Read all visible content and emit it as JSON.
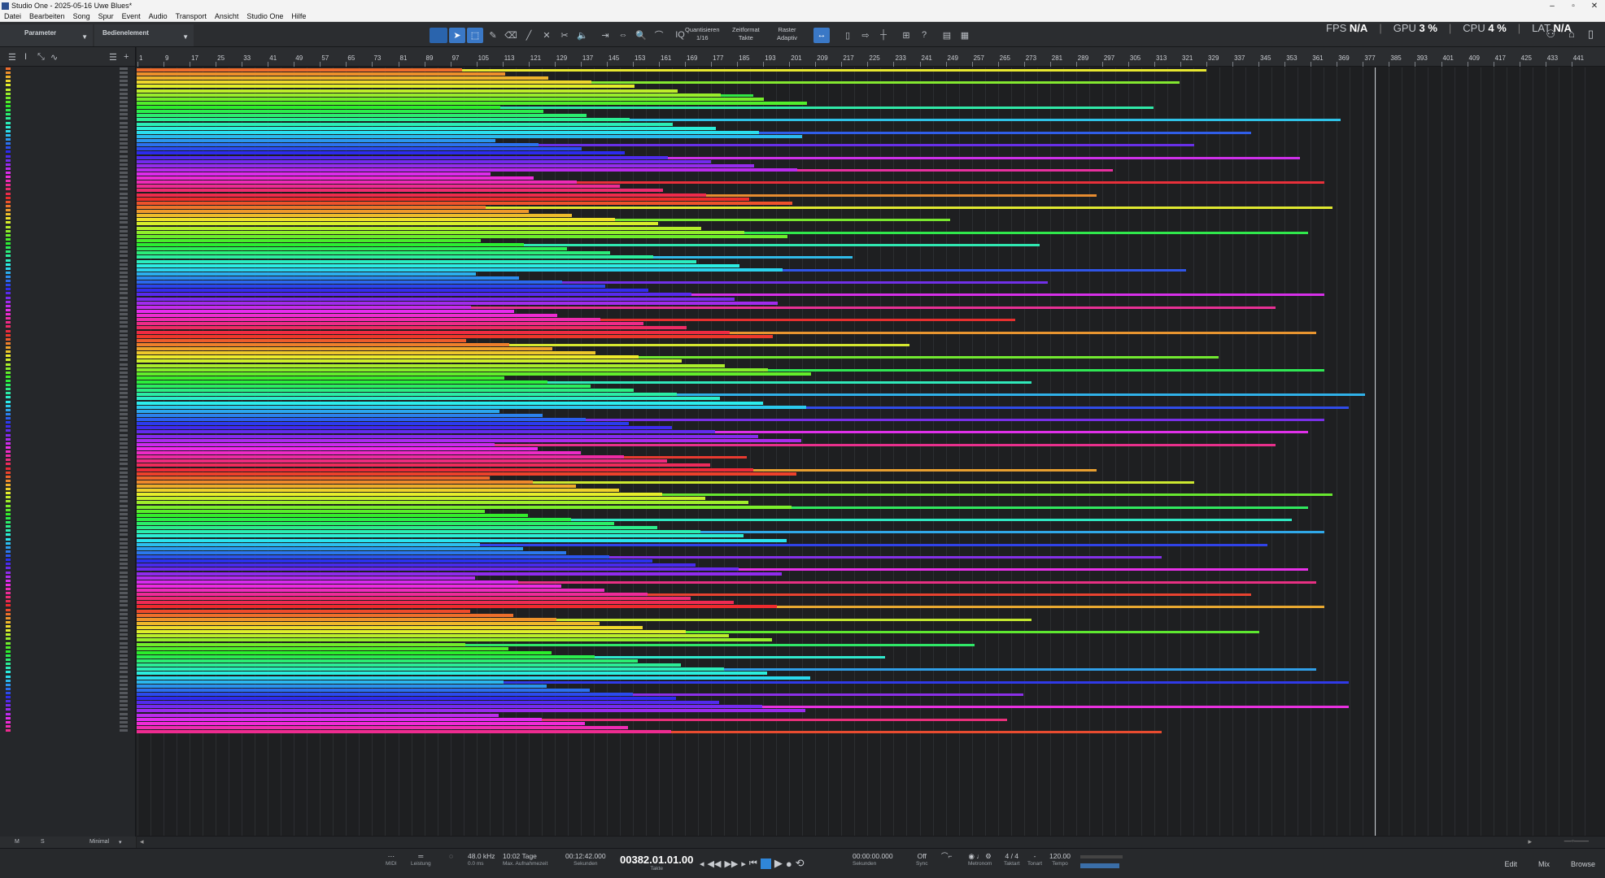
{
  "window": {
    "title": "Studio One - 2025-05-16 Uwe Blues*",
    "min": "–",
    "max": "▫",
    "close": "✕"
  },
  "menu": [
    "Datei",
    "Bearbeiten",
    "Song",
    "Spur",
    "Event",
    "Audio",
    "Transport",
    "Ansicht",
    "Studio One",
    "Hilfe"
  ],
  "toolbar": {
    "parameter_label": "Parameter",
    "bedienelement_label": "Bedienelement",
    "quantize": {
      "label": "Quantisieren",
      "value": "1/16"
    },
    "timeformat": {
      "label": "Zeitformat",
      "value": "Takte"
    },
    "raster": {
      "label": "Raster",
      "value": "Adaptiv"
    },
    "help": "?"
  },
  "stats": {
    "fps_label": "FPS",
    "fps_value": "N/A",
    "gpu_label": "GPU",
    "gpu_value": "3 %",
    "cpu_label": "CPU",
    "cpu_value": "4 %",
    "lat_label": "LAT",
    "lat_value": "N/A"
  },
  "leftpanel": {
    "m": "M",
    "s": "S",
    "view": "Minimal"
  },
  "ruler": {
    "labels": [
      "1",
      "9",
      "17",
      "25",
      "33",
      "41",
      "49",
      "57",
      "65",
      "73",
      "81",
      "89",
      "97",
      "105",
      "113",
      "121",
      "129",
      "137",
      "145",
      "153",
      "161",
      "169",
      "177",
      "185",
      "193",
      "201",
      "209",
      "217",
      "225",
      "233",
      "241",
      "249",
      "257",
      "265",
      "273",
      "281",
      "289",
      "297",
      "305",
      "313",
      "321",
      "329",
      "337",
      "345",
      "353",
      "361",
      "369",
      "377",
      "385",
      "393",
      "401",
      "409",
      "417",
      "425",
      "433",
      "441"
    ]
  },
  "transport": {
    "midi": "MIDI",
    "leistung": "Leistung",
    "samplerate": "48.0 kHz",
    "latency": "0.0 ms",
    "rec_time": "10:02 Tage",
    "rec_time_label": "Max. Aufnahmezeit",
    "seconds_value": "00:12:42.000",
    "seconds_label": "Sekunden",
    "position": "00382.01.01.00",
    "position_label": "Takte",
    "loop_l": "00:00:00.000",
    "loop_r": "Sekunden",
    "sync_value": "Off",
    "sync_label": "Sync",
    "metronom": "Metronom",
    "taktart_value": "4 / 4",
    "taktart_label": "Taktart",
    "tonart_value": "-",
    "tonart_label": "Tonart",
    "tempo_value": "120.00",
    "tempo_label": "Tempo"
  },
  "pages": {
    "edit": "Edit",
    "mix": "Mix",
    "browse": "Browse"
  },
  "icons": {
    "select": "arrow-icon",
    "pencil": "pencil-icon",
    "scissors": "split-icon",
    "speaker": "listen-icon"
  }
}
